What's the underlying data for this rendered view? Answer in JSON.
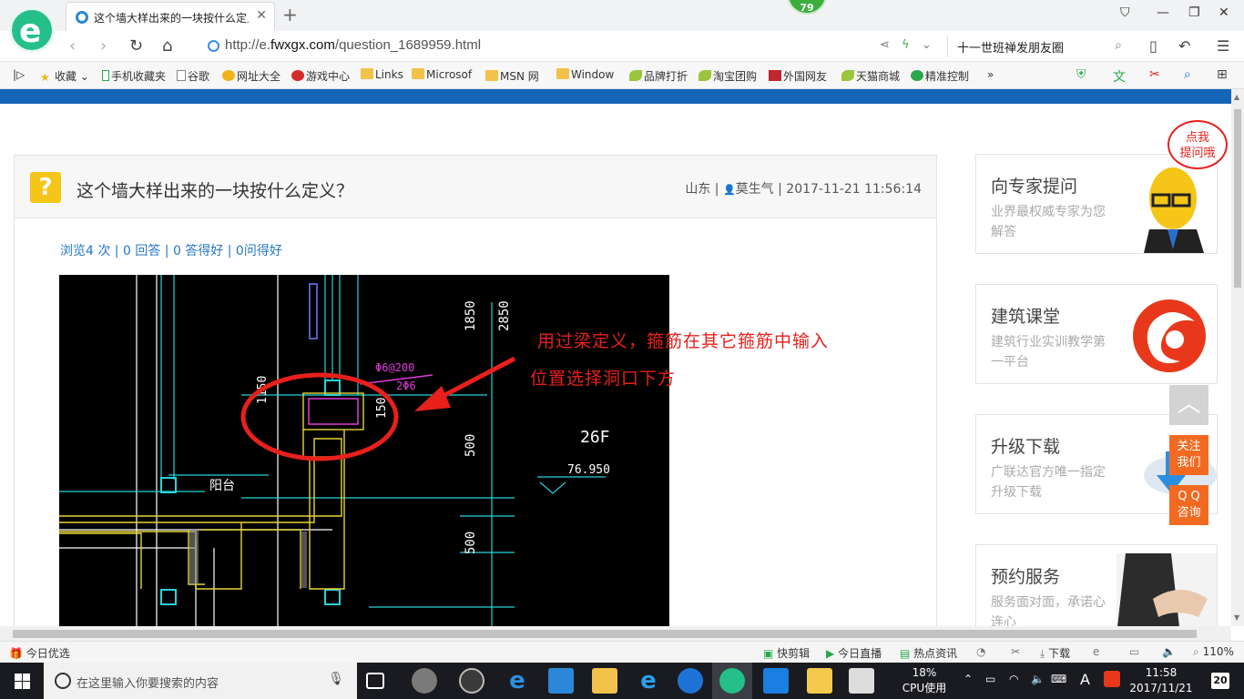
{
  "browser": {
    "tab_title": "这个墙大样出来的一块按什么定义",
    "badge_count": "79",
    "url_prefix": "http://e.",
    "url_domain": "fwxgx.com",
    "url_path": "/question_1689959.html",
    "search_value": "十一世班禅发朋友圈"
  },
  "bookmarks": {
    "items": [
      "收藏",
      "手机收藏夹",
      "谷歌",
      "网址大全",
      "游戏中心",
      "Links",
      "Microsof",
      "MSN 网",
      "Window",
      "品牌打折",
      "淘宝团购",
      "外国网友",
      "天猫商城",
      "精准控制"
    ],
    "more": "»"
  },
  "question": {
    "title": "这个墙大样出来的一块按什么定义？",
    "region": "山东",
    "user": "莫生气",
    "datetime": "2017-11-21 11:56:14",
    "separator": "|",
    "stats": "浏览4 次 | 0 回答 | 0 答得好 | 0问得好"
  },
  "drawing": {
    "dims": [
      "1850",
      "2850",
      "500",
      "500",
      "150",
      "1150"
    ],
    "rebar_note_1": "Φ6@200",
    "rebar_note_2": "2Φ6",
    "floor_label": "26F",
    "elevation": "76.950",
    "room_label": "阳台",
    "annotation_line1": "用过梁定义，箍筋在其它箍筋中输入",
    "annotation_line2": "位置选择洞口下方"
  },
  "sidebar": {
    "cards": [
      {
        "title": "向专家提问",
        "sub": "业界最权威专家为您解答"
      },
      {
        "title": "建筑课堂",
        "sub": "建筑行业实训教学第一平台"
      },
      {
        "title": "升级下载",
        "sub": "广联达官方唯一指定升级下载"
      },
      {
        "title": "预约服务",
        "sub": "服务面对面，承诺心连心"
      }
    ],
    "bubble": "点我\n提问哦",
    "bubble_line1": "点我",
    "bubble_line2": "提问哦",
    "follow_l1": "关注",
    "follow_l2": "我们",
    "qq_l1": "Q Q",
    "qq_l2": "咨询"
  },
  "statusbar": {
    "left": "今日优选",
    "items": [
      "快剪辑",
      "今日直播",
      "热点资讯",
      "下载"
    ],
    "zoom": "110%"
  },
  "taskbar": {
    "search_placeholder": "在这里输入你要搜索的内容",
    "cpu_percent": "18%",
    "cpu_label": "CPU使用",
    "ime": "A",
    "time": "11:58",
    "date": "2017/11/21",
    "notification_count": "20"
  },
  "colors": {
    "blue_strip": "#1565b8",
    "link_blue": "#2577c5",
    "annotation_red": "#e8201c",
    "float_orange": "#f26a22",
    "question_yellow": "#f5c518"
  }
}
